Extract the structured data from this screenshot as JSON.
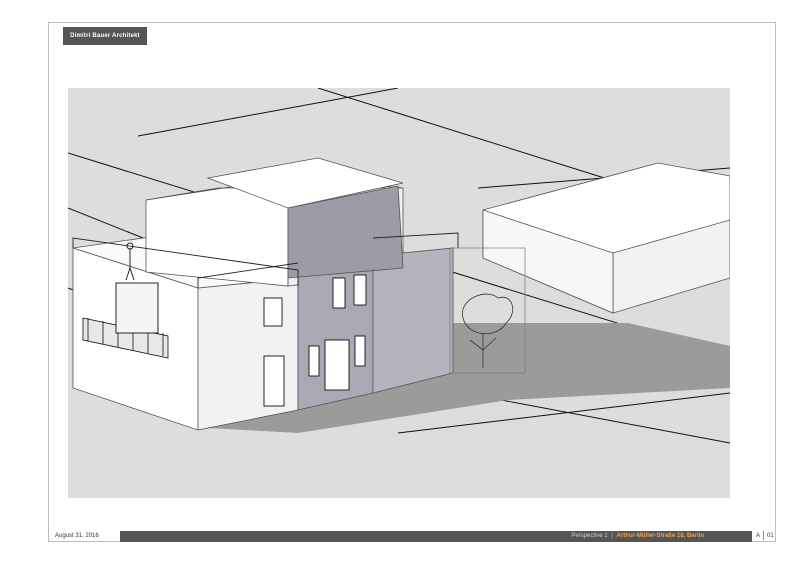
{
  "header": {
    "firm_name": "Dimitri Bauer Architekt"
  },
  "footer": {
    "date": "August 31, 2016",
    "view_label": "Perspective 1",
    "separator": "|",
    "address": "Arthur-Müller-Straße 16, Berlin",
    "sheet_letter": "A",
    "page_number": "01"
  },
  "colors": {
    "frame": "#bdbdbd",
    "badge": "#555555",
    "footer_bar": "#555555",
    "address_accent": "#f2a14a",
    "viewport_background": "#dddddd"
  }
}
